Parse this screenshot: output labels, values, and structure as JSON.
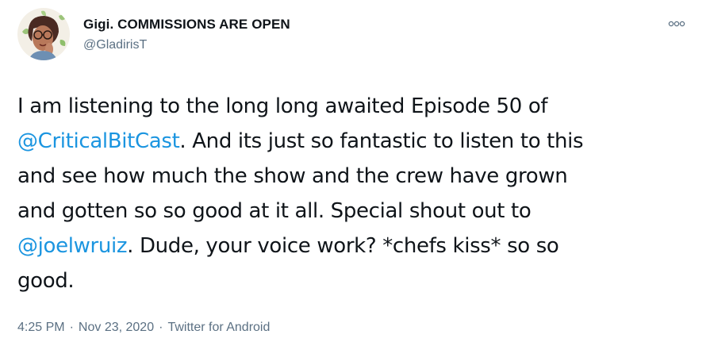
{
  "author": {
    "display_name": "Gigi. COMMISSIONS ARE OPEN",
    "handle": "@GladirisT"
  },
  "menu": {
    "icon": "more-options-icon"
  },
  "tweet": {
    "lines": [
      [
        {
          "text": "I am listening to the long long awaited Episode 50 of",
          "mention": false
        }
      ],
      [
        {
          "text": "@CriticalBitCast",
          "mention": true
        },
        {
          "text": ". And its just so fantastic to listen to this",
          "mention": false
        }
      ],
      [
        {
          "text": "and see how much the show and the crew have grown",
          "mention": false
        }
      ],
      [
        {
          "text": "and gotten so so good at it all. Special shout out to",
          "mention": false
        }
      ],
      [
        {
          "text": "@joelwruiz",
          "mention": true
        },
        {
          "text": ". Dude, your voice work? *chefs kiss* so so",
          "mention": false
        }
      ],
      [
        {
          "text": "good.",
          "mention": false
        }
      ]
    ]
  },
  "meta": {
    "time": "4:25 PM",
    "separator": "·",
    "date": "Nov 23, 2020",
    "source": "Twitter for Android"
  },
  "colors": {
    "text": "#0f1419",
    "secondary": "#5b7083",
    "link": "#1b95e0"
  }
}
